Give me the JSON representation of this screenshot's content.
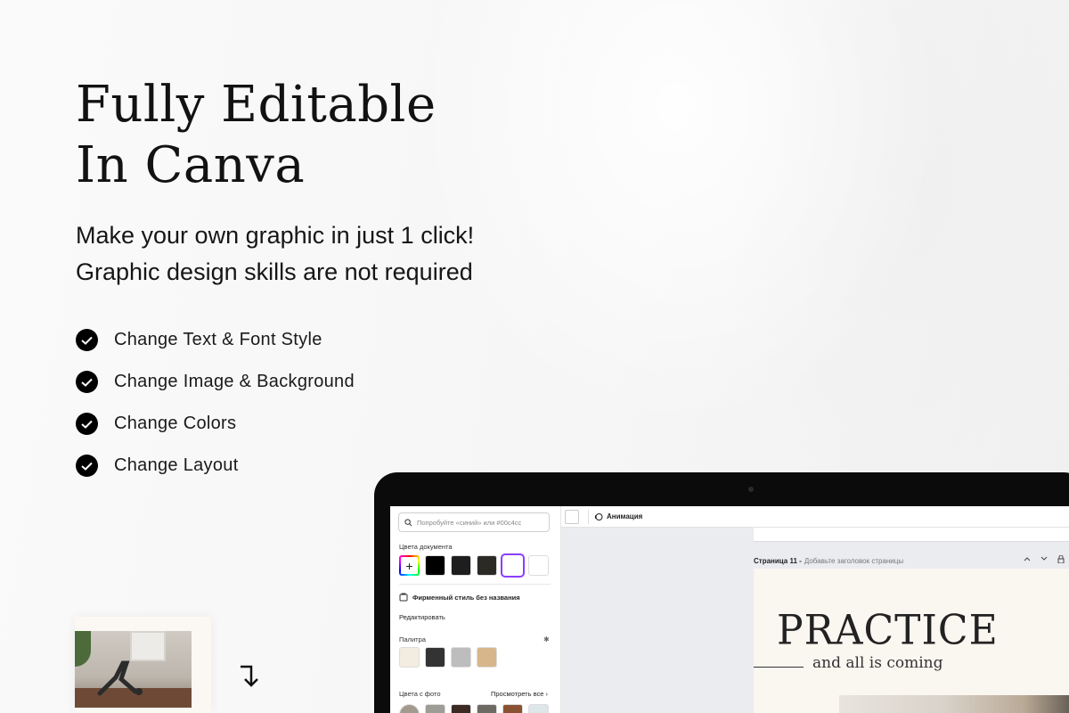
{
  "hero": {
    "title_line1": "Fully Editable",
    "title_line2": "In Canva",
    "subtitle_line1": "Make your own graphic in just 1 click!",
    "subtitle_line2": "Graphic design skills are not required"
  },
  "features": [
    "Change Text & Font Style",
    "Change Image & Background",
    "Change Colors",
    "Change Layout"
  ],
  "panel": {
    "search_placeholder": "Попробуйте «синий» или #00c4cc",
    "doc_colors_label": "Цвета документа",
    "doc_colors": [
      "#000000",
      "#1e1e1e",
      "#2b2a24",
      "#ffffff",
      "#ffffff"
    ],
    "brand_label": "Фирменный стиль без названия",
    "edit_label": "Редактировать",
    "palette_label": "Палитра",
    "palette_colors": [
      "#f3ece0",
      "#333333",
      "#bdbdbd",
      "#d7b68b"
    ],
    "photo_colors_label": "Цвета с фото",
    "view_all_label": "Просмотреть все",
    "photo_colors": [
      "#a39a8e",
      "#9e9c97",
      "#3b2b24",
      "#6d6a64",
      "#8a5232",
      "#dde6e8"
    ]
  },
  "editor": {
    "animation_label": "Анимация",
    "page_number": "Страница 11 -",
    "page_title_hint": "Добавьте заголовок страницы",
    "design_title": "PRACTICE",
    "design_subtitle": "and all is coming"
  },
  "colors": {
    "accent": "#8b3dff",
    "check_bg": "#000000"
  }
}
